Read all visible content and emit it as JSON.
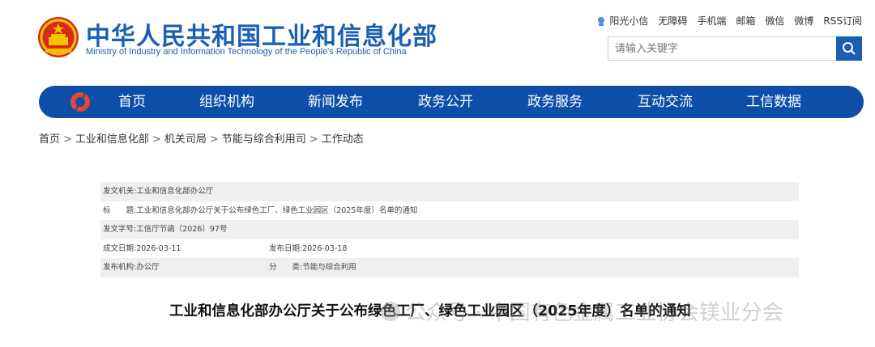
{
  "header": {
    "title_cn": "中华人民共和国工业和信息化部",
    "title_en": "Ministry of Industry and Information Technology of the People's Republic of China",
    "top_links": [
      "阳光小信",
      "无障碍",
      "手机端",
      "邮箱",
      "微信",
      "微博",
      "RSS订阅"
    ],
    "search_placeholder": "请输入关键字"
  },
  "nav": {
    "items": [
      "首页",
      "组织机构",
      "新闻发布",
      "政务公开",
      "政务服务",
      "互动交流",
      "工信数据"
    ]
  },
  "breadcrumb": [
    "首页",
    "工业和信息化部",
    "机关司局",
    "节能与综合利用司",
    "工作动态"
  ],
  "breadcrumb_sep": ">",
  "meta": {
    "issuer_label": "发文机关:",
    "issuer": "工业和信息化部办公厅",
    "title_label": "标　　题:",
    "title": "工业和信息化部办公厅关于公布绿色工厂、绿色工业园区（2025年度）名单的通知",
    "doc_no_label": "发文字号:",
    "doc_no": "工信厅节函〔2026〕97号",
    "created_label": "成文日期:",
    "created": "2026-03-11",
    "published_label": "发布日期:",
    "published": "2026-03-18",
    "org_label": "发布机构:",
    "org": "办公厅",
    "category_label": "分　　类:",
    "category": "节能与综合利用"
  },
  "article_title": "工业和信息化部办公厅关于公布绿色工厂、绿色工业园区（2025年度）名单的通知",
  "watermark": "公众号 · 中国有色金属工业协会镁业分会",
  "colors": {
    "brand_blue": "#1a5fb4",
    "nav_blue": "#0d4fa8",
    "emblem_red": "#d52b1e",
    "emblem_gold": "#f3c300"
  }
}
